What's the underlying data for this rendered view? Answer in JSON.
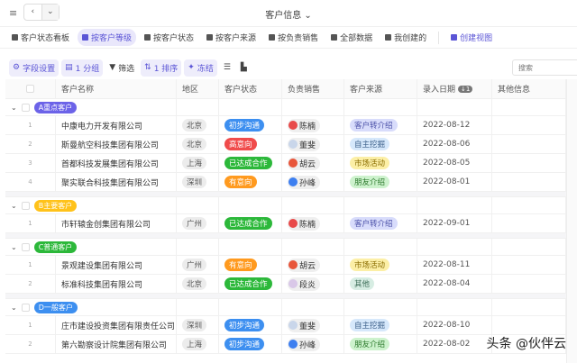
{
  "header": {
    "title": "客户信息"
  },
  "views": [
    {
      "label": "客户状态看板",
      "active": false
    },
    {
      "label": "按客户等级",
      "active": true
    },
    {
      "label": "按客户状态",
      "active": false
    },
    {
      "label": "按客户来源",
      "active": false
    },
    {
      "label": "按负责销售",
      "active": false
    },
    {
      "label": "全部数据",
      "active": false
    },
    {
      "label": "我创建的",
      "active": false
    }
  ],
  "create_view": "创建视图",
  "toolbar": {
    "fields": "字段设置",
    "group": "1 分组",
    "filter": "筛选",
    "sort": "1 排序",
    "freeze": "冻结",
    "search_placeholder": "搜索"
  },
  "columns": [
    "客户名称",
    "地区",
    "客户状态",
    "负责销售",
    "客户来源",
    "录入日期",
    "其他信息"
  ],
  "date_sort_badge": "1",
  "colors": {
    "accent": "#5b55d6",
    "初步沟通": "#3d8ff0",
    "高意向": "#f04b4b",
    "已达成合作": "#2cb83a",
    "有意向": "#ff9a1f"
  },
  "groups": [
    {
      "label": "A重点客户",
      "color": "#6c63e8",
      "rows": [
        {
          "n": "1",
          "name": "中康电力开发有限公司",
          "region": "北京",
          "status": "初步沟通",
          "sales": "陈楠",
          "source": "客户转介绍",
          "date": "2022-08-12"
        },
        {
          "n": "2",
          "name": "斯曼航空科技集团有限公司",
          "region": "北京",
          "status": "高意向",
          "sales": "董斐",
          "source": "自主挖掘",
          "date": "2022-08-06"
        },
        {
          "n": "3",
          "name": "首都科技发展集团有限公司",
          "region": "上海",
          "status": "已达成合作",
          "sales": "胡云",
          "source": "市场活动",
          "date": "2022-08-05"
        },
        {
          "n": "4",
          "name": "聚实联合科技集团有限公司",
          "region": "深圳",
          "status": "有意向",
          "sales": "孙峰",
          "source": "朋友介绍",
          "date": "2022-08-01"
        }
      ]
    },
    {
      "label": "B主要客户",
      "color": "#ffc21a",
      "rows": [
        {
          "n": "1",
          "name": "市轩辕金创集团有限公司",
          "region": "广州",
          "status": "已达成合作",
          "sales": "陈楠",
          "source": "客户转介绍",
          "date": "2022-09-01"
        }
      ]
    },
    {
      "label": "C普通客户",
      "color": "#2cb83a",
      "rows": [
        {
          "n": "1",
          "name": "景观建设集团有限公司",
          "region": "广州",
          "status": "有意向",
          "sales": "胡云",
          "source": "市场活动",
          "date": "2022-08-11"
        },
        {
          "n": "2",
          "name": "标准科技集团有限公司",
          "region": "北京",
          "status": "已达成合作",
          "sales": "段炎",
          "source": "其他",
          "date": "2022-08-04"
        }
      ]
    },
    {
      "label": "D一般客户",
      "color": "#3d8ff0",
      "rows": [
        {
          "n": "1",
          "name": "庄市建设投资集团有限责任公司",
          "region": "深圳",
          "status": "初步沟通",
          "sales": "董斐",
          "source": "自主挖掘",
          "date": "2022-08-10"
        },
        {
          "n": "2",
          "name": "第六勘察设计院集团有限公司",
          "region": "上海",
          "status": "初步沟通",
          "sales": "孙峰",
          "source": "朋友介绍",
          "date": "2022-08-02"
        }
      ]
    }
  ],
  "watermark": "头条 @伙伴云"
}
